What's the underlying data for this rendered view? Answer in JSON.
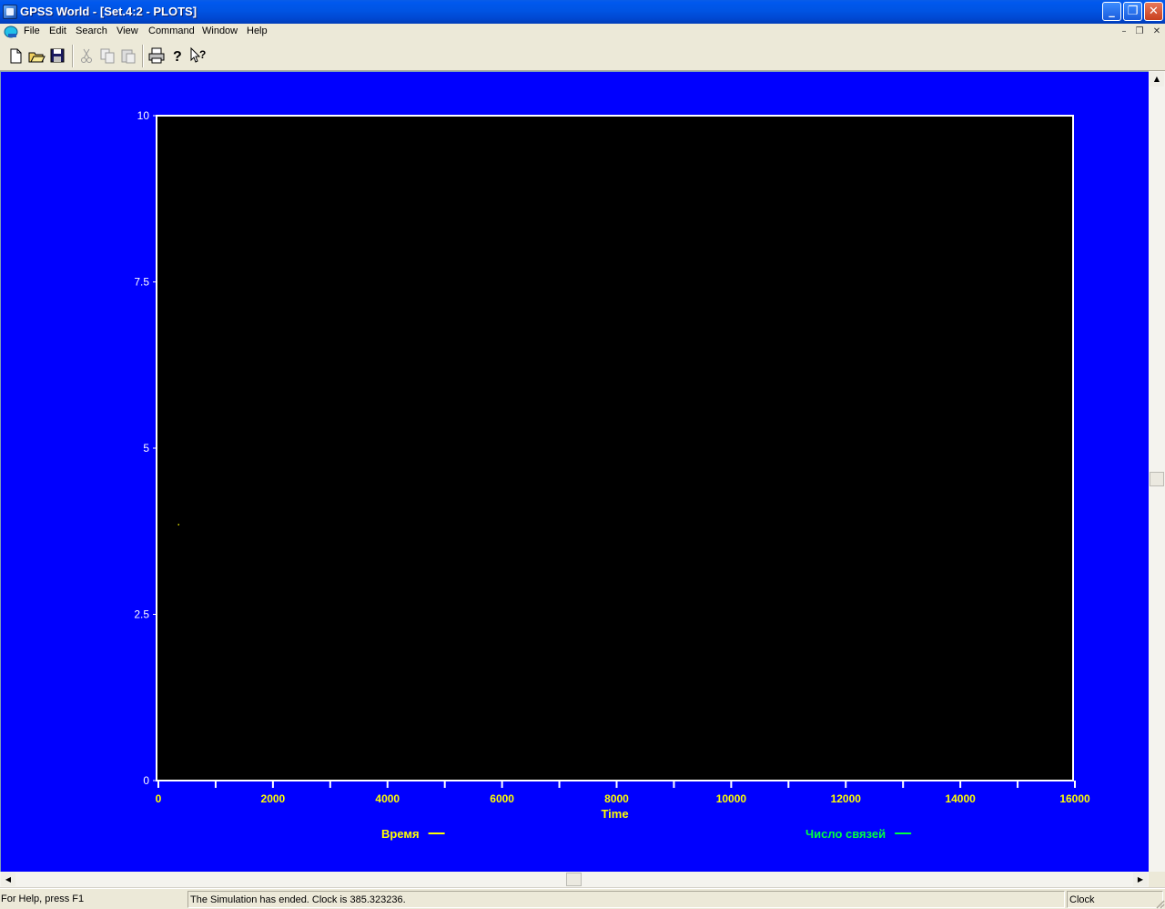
{
  "window": {
    "title": "GPSS World - [Set.4:2  -  PLOTS]",
    "minimize_glyph": "_",
    "maximize_glyph": "❐",
    "close_glyph": "✕"
  },
  "menu": {
    "items": [
      "File",
      "Edit",
      "Search",
      "View",
      "Command",
      "Window",
      "Help"
    ],
    "mdi_minimize": "–",
    "mdi_restore": "❐",
    "mdi_close": "✕"
  },
  "toolbar": {
    "tools": [
      "new-icon",
      "open-icon",
      "save-icon",
      "cut-icon",
      "copy-icon",
      "paste-icon",
      "print-icon",
      "help-icon",
      "context-help-icon"
    ]
  },
  "chart_data": {
    "type": "line",
    "background": "#000000",
    "page_background": "#0000ff",
    "xlabel": "Time",
    "ylabel": "",
    "xlim": [
      0,
      16000
    ],
    "ylim": [
      0,
      10
    ],
    "x_tick_values": [
      0,
      2000,
      4000,
      6000,
      8000,
      10000,
      12000,
      14000,
      16000
    ],
    "x_tick_labels": [
      "0",
      "2000",
      "4000",
      "6000",
      "8000",
      "10000",
      "12000",
      "14000",
      "16000"
    ],
    "x_minor_step": 1000,
    "y_tick_values": [
      0,
      2.5,
      5,
      7.5,
      10
    ],
    "y_tick_labels": [
      "0",
      "2.5",
      "5",
      "7.5",
      "10"
    ],
    "grid": false,
    "series": [
      {
        "name": "Время",
        "color": "#ffff00",
        "points": [
          [
            385,
            3.85
          ]
        ]
      },
      {
        "name": "Число связей",
        "color": "#00ff40",
        "points": []
      }
    ]
  },
  "status": {
    "help": "For Help, press F1",
    "message": "The Simulation has ended.  Clock is 385.323236.",
    "clock": "Clock"
  },
  "scroll": {
    "up": "▲",
    "down": "▼",
    "left": "◀",
    "right": "▶"
  }
}
